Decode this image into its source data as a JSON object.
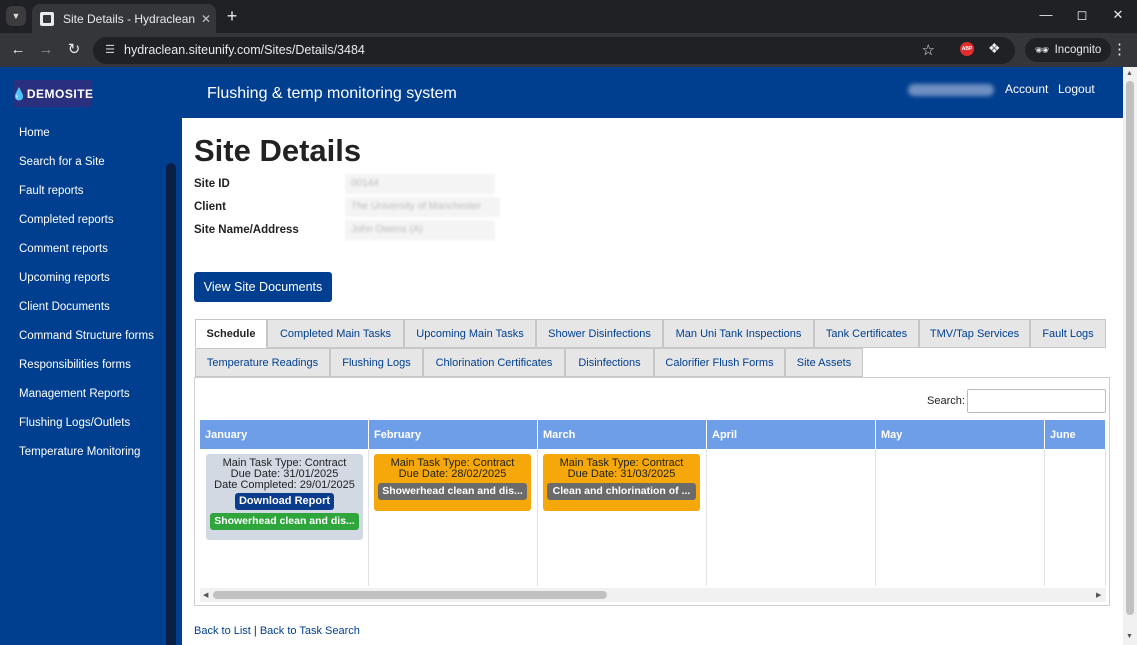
{
  "browser": {
    "tab_title": "Site Details - Hydraclean",
    "url": "hydraclean.siteunify.com/Sites/Details/3484",
    "incognito_label": "Incognito",
    "abp_label": "ABP",
    "icons": [
      "tab-list-icon",
      "favicon-icon",
      "close-icon",
      "plus-icon",
      "minimize-icon",
      "maximize-icon",
      "close-window-icon",
      "back-icon",
      "forward-icon",
      "reload-icon",
      "site-info-icon",
      "star-icon",
      "extensions-icon",
      "incognito-icon",
      "menu-icon"
    ]
  },
  "header": {
    "logo_text": "DEMOSITE",
    "app_title": "Flushing & temp monitoring system",
    "account_label": "Account",
    "logout_label": "Logout"
  },
  "sidebar": {
    "items": [
      {
        "label": "Home"
      },
      {
        "label": "Search for a Site"
      },
      {
        "label": "Fault reports"
      },
      {
        "label": "Completed reports"
      },
      {
        "label": "Comment reports"
      },
      {
        "label": "Upcoming reports"
      },
      {
        "label": "Client Documents"
      },
      {
        "label": "Command Structure forms"
      },
      {
        "label": "Responsibilities forms"
      },
      {
        "label": "Management Reports"
      },
      {
        "label": "Flushing Logs/Outlets"
      },
      {
        "label": "Temperature Monitoring"
      }
    ]
  },
  "main": {
    "title": "Site Details",
    "fields": [
      {
        "label": "Site ID",
        "value": "00144"
      },
      {
        "label": "Client",
        "value": "The University of Manchester"
      },
      {
        "label": "Site Name/Address",
        "value": "John Owens (A)"
      }
    ],
    "view_docs_label": "View Site Documents",
    "tabs_row1": [
      {
        "label": "Schedule",
        "active": true
      },
      {
        "label": "Completed Main Tasks"
      },
      {
        "label": "Upcoming Main Tasks"
      },
      {
        "label": "Shower Disinfections"
      },
      {
        "label": "Man Uni Tank Inspections"
      },
      {
        "label": "Tank Certificates"
      },
      {
        "label": "TMV/Tap Services"
      },
      {
        "label": "Fault Logs"
      }
    ],
    "tabs_row2": [
      {
        "label": "Temperature Readings"
      },
      {
        "label": "Flushing Logs"
      },
      {
        "label": "Chlorination Certificates"
      },
      {
        "label": "Disinfections"
      },
      {
        "label": "Calorifier Flush Forms"
      },
      {
        "label": "Site Assets"
      }
    ],
    "search_label": "Search:",
    "search_value": "",
    "months": [
      "January",
      "February",
      "March",
      "April",
      "May",
      "June"
    ],
    "cards": {
      "january": {
        "type": "Main Task Type: Contract",
        "due": "Due Date: 31/01/2025",
        "completed": "Date Completed: 29/01/2025",
        "download_label": "Download Report",
        "chip": "Showerhead clean and dis...",
        "color": "#d2d9e3",
        "chip_color": "#2ea63b"
      },
      "february": {
        "type": "Main Task Type: Contract",
        "due": "Due Date: 28/02/2025",
        "chip": "Showerhead clean and dis...",
        "color": "#f6a70a",
        "chip_color": "#6b6b6b"
      },
      "march": {
        "type": "Main Task Type: Contract",
        "due": "Due Date: 31/03/2025",
        "chip": "Clean and chlorination of ...",
        "color": "#f6a70a",
        "chip_color": "#6b6b6b"
      }
    },
    "footer": {
      "back_to_list": "Back to List",
      "separator": "|",
      "back_to_task_search": "Back to Task Search"
    }
  },
  "colors": {
    "brand": "#003f8f",
    "month_header": "#6f9ee8"
  }
}
